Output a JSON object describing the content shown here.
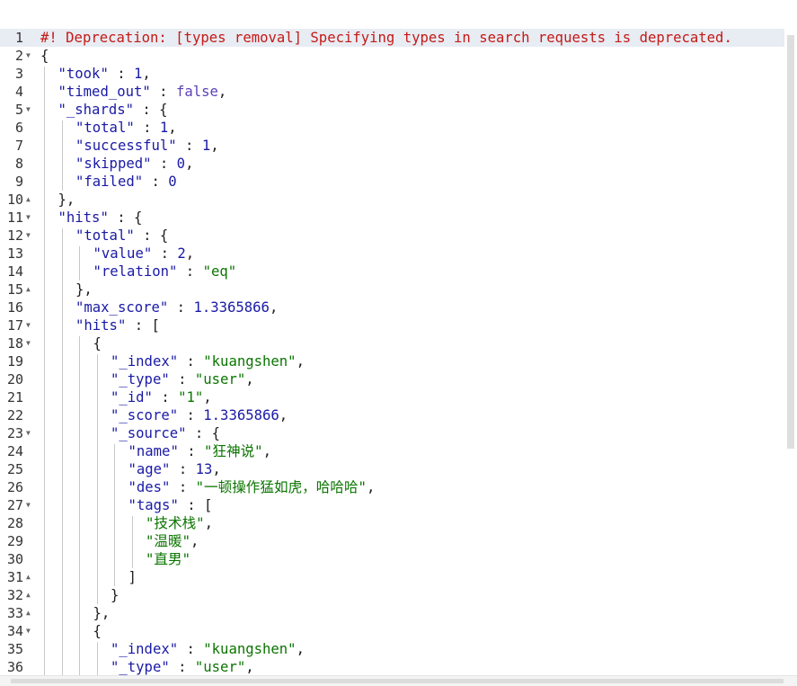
{
  "editor": {
    "lines": [
      {
        "n": "1",
        "indent": 0,
        "fold": "",
        "active": true,
        "tokens": [
          {
            "t": "#! Deprecation: [types removal] Specifying types in search requests is deprecated.",
            "c": "warn"
          }
        ]
      },
      {
        "n": "2",
        "indent": 0,
        "fold": "open",
        "tokens": [
          {
            "t": "{",
            "c": "p"
          }
        ]
      },
      {
        "n": "3",
        "indent": 1,
        "fold": "",
        "tokens": [
          {
            "t": "\"took\"",
            "c": "k"
          },
          {
            "t": " : ",
            "c": "p"
          },
          {
            "t": "1",
            "c": "num"
          },
          {
            "t": ",",
            "c": "p"
          }
        ]
      },
      {
        "n": "4",
        "indent": 1,
        "fold": "",
        "tokens": [
          {
            "t": "\"timed_out\"",
            "c": "k"
          },
          {
            "t": " : ",
            "c": "p"
          },
          {
            "t": "false",
            "c": "bool"
          },
          {
            "t": ",",
            "c": "p"
          }
        ]
      },
      {
        "n": "5",
        "indent": 1,
        "fold": "open",
        "tokens": [
          {
            "t": "\"_shards\"",
            "c": "k"
          },
          {
            "t": " : {",
            "c": "p"
          }
        ]
      },
      {
        "n": "6",
        "indent": 2,
        "fold": "",
        "tokens": [
          {
            "t": "\"total\"",
            "c": "k"
          },
          {
            "t": " : ",
            "c": "p"
          },
          {
            "t": "1",
            "c": "num"
          },
          {
            "t": ",",
            "c": "p"
          }
        ]
      },
      {
        "n": "7",
        "indent": 2,
        "fold": "",
        "tokens": [
          {
            "t": "\"successful\"",
            "c": "k"
          },
          {
            "t": " : ",
            "c": "p"
          },
          {
            "t": "1",
            "c": "num"
          },
          {
            "t": ",",
            "c": "p"
          }
        ]
      },
      {
        "n": "8",
        "indent": 2,
        "fold": "",
        "tokens": [
          {
            "t": "\"skipped\"",
            "c": "k"
          },
          {
            "t": " : ",
            "c": "p"
          },
          {
            "t": "0",
            "c": "num"
          },
          {
            "t": ",",
            "c": "p"
          }
        ]
      },
      {
        "n": "9",
        "indent": 2,
        "fold": "",
        "tokens": [
          {
            "t": "\"failed\"",
            "c": "k"
          },
          {
            "t": " : ",
            "c": "p"
          },
          {
            "t": "0",
            "c": "num"
          }
        ]
      },
      {
        "n": "10",
        "indent": 1,
        "fold": "close",
        "tokens": [
          {
            "t": "},",
            "c": "p"
          }
        ]
      },
      {
        "n": "11",
        "indent": 1,
        "fold": "open",
        "tokens": [
          {
            "t": "\"hits\"",
            "c": "k"
          },
          {
            "t": " : {",
            "c": "p"
          }
        ]
      },
      {
        "n": "12",
        "indent": 2,
        "fold": "open",
        "tokens": [
          {
            "t": "\"total\"",
            "c": "k"
          },
          {
            "t": " : {",
            "c": "p"
          }
        ]
      },
      {
        "n": "13",
        "indent": 3,
        "fold": "",
        "tokens": [
          {
            "t": "\"value\"",
            "c": "k"
          },
          {
            "t": " : ",
            "c": "p"
          },
          {
            "t": "2",
            "c": "num"
          },
          {
            "t": ",",
            "c": "p"
          }
        ]
      },
      {
        "n": "14",
        "indent": 3,
        "fold": "",
        "tokens": [
          {
            "t": "\"relation\"",
            "c": "k"
          },
          {
            "t": " : ",
            "c": "p"
          },
          {
            "t": "\"eq\"",
            "c": "str"
          }
        ]
      },
      {
        "n": "15",
        "indent": 2,
        "fold": "close",
        "tokens": [
          {
            "t": "},",
            "c": "p"
          }
        ]
      },
      {
        "n": "16",
        "indent": 2,
        "fold": "",
        "tokens": [
          {
            "t": "\"max_score\"",
            "c": "k"
          },
          {
            "t": " : ",
            "c": "p"
          },
          {
            "t": "1.3365866",
            "c": "num"
          },
          {
            "t": ",",
            "c": "p"
          }
        ]
      },
      {
        "n": "17",
        "indent": 2,
        "fold": "open",
        "tokens": [
          {
            "t": "\"hits\"",
            "c": "k"
          },
          {
            "t": " : [",
            "c": "p"
          }
        ]
      },
      {
        "n": "18",
        "indent": 3,
        "fold": "open",
        "tokens": [
          {
            "t": "{",
            "c": "p"
          }
        ]
      },
      {
        "n": "19",
        "indent": 4,
        "fold": "",
        "tokens": [
          {
            "t": "\"_index\"",
            "c": "k"
          },
          {
            "t": " : ",
            "c": "p"
          },
          {
            "t": "\"kuangshen\"",
            "c": "str"
          },
          {
            "t": ",",
            "c": "p"
          }
        ]
      },
      {
        "n": "20",
        "indent": 4,
        "fold": "",
        "tokens": [
          {
            "t": "\"_type\"",
            "c": "k"
          },
          {
            "t": " : ",
            "c": "p"
          },
          {
            "t": "\"user\"",
            "c": "str"
          },
          {
            "t": ",",
            "c": "p"
          }
        ]
      },
      {
        "n": "21",
        "indent": 4,
        "fold": "",
        "tokens": [
          {
            "t": "\"_id\"",
            "c": "k"
          },
          {
            "t": " : ",
            "c": "p"
          },
          {
            "t": "\"1\"",
            "c": "str"
          },
          {
            "t": ",",
            "c": "p"
          }
        ]
      },
      {
        "n": "22",
        "indent": 4,
        "fold": "",
        "tokens": [
          {
            "t": "\"_score\"",
            "c": "k"
          },
          {
            "t": " : ",
            "c": "p"
          },
          {
            "t": "1.3365866",
            "c": "num"
          },
          {
            "t": ",",
            "c": "p"
          }
        ]
      },
      {
        "n": "23",
        "indent": 4,
        "fold": "open",
        "tokens": [
          {
            "t": "\"_source\"",
            "c": "k"
          },
          {
            "t": " : {",
            "c": "p"
          }
        ]
      },
      {
        "n": "24",
        "indent": 5,
        "fold": "",
        "tokens": [
          {
            "t": "\"name\"",
            "c": "k"
          },
          {
            "t": " : ",
            "c": "p"
          },
          {
            "t": "\"狂神说\"",
            "c": "str"
          },
          {
            "t": ",",
            "c": "p"
          }
        ]
      },
      {
        "n": "25",
        "indent": 5,
        "fold": "",
        "tokens": [
          {
            "t": "\"age\"",
            "c": "k"
          },
          {
            "t": " : ",
            "c": "p"
          },
          {
            "t": "13",
            "c": "num"
          },
          {
            "t": ",",
            "c": "p"
          }
        ]
      },
      {
        "n": "26",
        "indent": 5,
        "fold": "",
        "tokens": [
          {
            "t": "\"des\"",
            "c": "k"
          },
          {
            "t": " : ",
            "c": "p"
          },
          {
            "t": "\"一顿操作猛如虎，哈哈哈\"",
            "c": "str"
          },
          {
            "t": ",",
            "c": "p"
          }
        ]
      },
      {
        "n": "27",
        "indent": 5,
        "fold": "open",
        "tokens": [
          {
            "t": "\"tags\"",
            "c": "k"
          },
          {
            "t": " : [",
            "c": "p"
          }
        ]
      },
      {
        "n": "28",
        "indent": 6,
        "fold": "",
        "tokens": [
          {
            "t": "\"技术栈\"",
            "c": "str"
          },
          {
            "t": ",",
            "c": "p"
          }
        ]
      },
      {
        "n": "29",
        "indent": 6,
        "fold": "",
        "tokens": [
          {
            "t": "\"温暖\"",
            "c": "str"
          },
          {
            "t": ",",
            "c": "p"
          }
        ]
      },
      {
        "n": "30",
        "indent": 6,
        "fold": "",
        "tokens": [
          {
            "t": "\"直男\"",
            "c": "str"
          }
        ]
      },
      {
        "n": "31",
        "indent": 5,
        "fold": "close",
        "tokens": [
          {
            "t": "]",
            "c": "p"
          }
        ]
      },
      {
        "n": "32",
        "indent": 4,
        "fold": "close",
        "tokens": [
          {
            "t": "}",
            "c": "p"
          }
        ]
      },
      {
        "n": "33",
        "indent": 3,
        "fold": "close",
        "tokens": [
          {
            "t": "},",
            "c": "p"
          }
        ]
      },
      {
        "n": "34",
        "indent": 3,
        "fold": "open",
        "tokens": [
          {
            "t": "{",
            "c": "p"
          }
        ]
      },
      {
        "n": "35",
        "indent": 4,
        "fold": "",
        "tokens": [
          {
            "t": "\"_index\"",
            "c": "k"
          },
          {
            "t": " : ",
            "c": "p"
          },
          {
            "t": "\"kuangshen\"",
            "c": "str"
          },
          {
            "t": ",",
            "c": "p"
          }
        ]
      },
      {
        "n": "36",
        "indent": 4,
        "fold": "",
        "tokens": [
          {
            "t": "\"_type\"",
            "c": "k"
          },
          {
            "t": " : ",
            "c": "p"
          },
          {
            "t": "\"user\"",
            "c": "str"
          },
          {
            "t": ",",
            "c": "p"
          }
        ]
      }
    ]
  },
  "icons": {
    "fold_open": "caret-down-icon",
    "fold_close": "caret-up-icon"
  },
  "colors": {
    "key": "#1a1aa6",
    "string": "#0b7500",
    "number": "#1a1aa6",
    "boolean": "#5c42b8",
    "warning": "#c41a16",
    "active_line": "#e8ecf3"
  }
}
